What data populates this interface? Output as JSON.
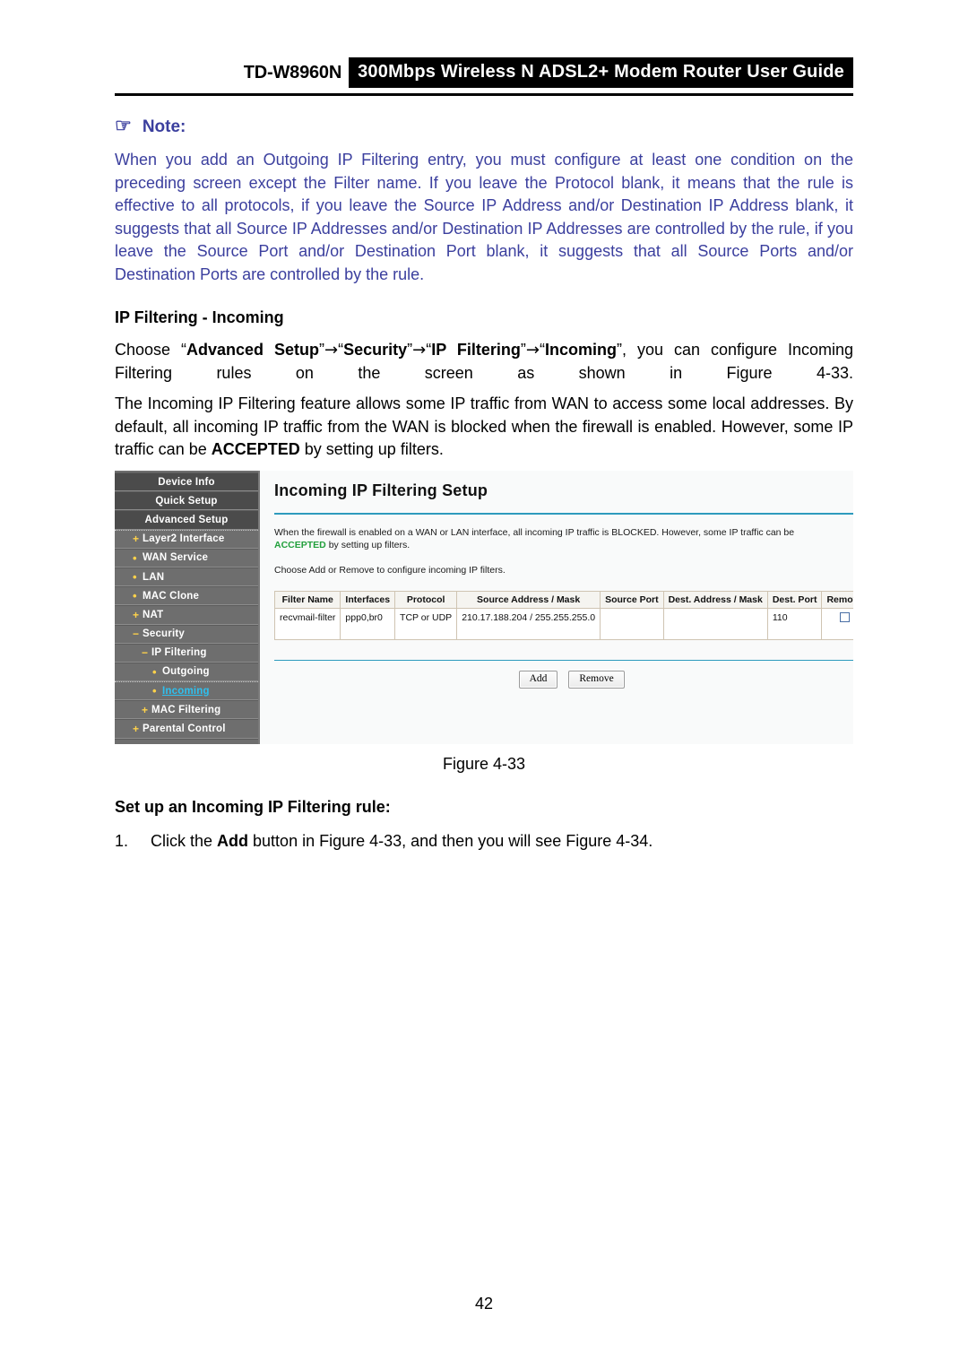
{
  "header": {
    "model": "TD-W8960N",
    "banner": "300Mbps Wireless N ADSL2+ Modem Router User Guide"
  },
  "note": {
    "icon": "pointing-hand",
    "icon_glyph": "☞",
    "label": "Note:",
    "color": "#3b3f9e",
    "body": "When you add an Outgoing IP Filtering entry, you must configure at least one condition on the preceding screen except the Filter name. If you leave the Protocol blank, it means that the rule is effective to all protocols, if you leave the Source IP Address and/or Destination IP Address blank, it suggests that all Source IP Addresses and/or Destination IP Addresses are controlled by the rule, if you leave the Source Port and/or Destination Port blank, it suggests that all Source Ports and/or Destination Ports are controlled by the rule."
  },
  "section": {
    "heading": "IP Filtering - Incoming",
    "choose_prefix": "Choose ",
    "path": [
      {
        "quote_open": "“",
        "bold": "Advanced Setup",
        "quote_close": "”"
      },
      {
        "quote_open": "“",
        "bold": "Security",
        "quote_close": "”"
      },
      {
        "quote_open": "“",
        "bold": "IP Filtering",
        "quote_close": "”"
      },
      {
        "quote_open": "“",
        "bold": "Incoming",
        "quote_close": "”"
      }
    ],
    "arrow": "→",
    "choose_suffix": ", you can configure Incoming Filtering rules on the screen as shown in Figure 4-33.",
    "feature_para_1": "The Incoming IP Filtering feature allows some IP traffic from WAN to access some local addresses. By default, all incoming IP traffic from the WAN is blocked when the firewall is enabled. However, some IP traffic can be ",
    "feature_accepted": "ACCEPTED",
    "feature_para_2": " by setting up filters."
  },
  "figure": {
    "caption": "Figure 4-33",
    "sidebar": {
      "items": [
        {
          "label": "Device Info",
          "level": "top",
          "marker": ""
        },
        {
          "label": "Quick Setup",
          "level": "top",
          "marker": ""
        },
        {
          "label": "Advanced Setup",
          "level": "top",
          "marker": ""
        },
        {
          "label": "Layer2 Interface",
          "level": "lvl1",
          "marker": "+"
        },
        {
          "label": "WAN Service",
          "level": "lvl1",
          "marker": "•"
        },
        {
          "label": "LAN",
          "level": "lvl1",
          "marker": "•"
        },
        {
          "label": "MAC Clone",
          "level": "lvl1",
          "marker": "•"
        },
        {
          "label": "NAT",
          "level": "lvl1",
          "marker": "+"
        },
        {
          "label": "Security",
          "level": "lvl1",
          "marker": "−"
        },
        {
          "label": "IP Filtering",
          "level": "lvl2",
          "marker": "−"
        },
        {
          "label": "Outgoing",
          "level": "lvl3",
          "marker": "•"
        },
        {
          "label": "Incoming",
          "level": "lvl3",
          "marker": "•",
          "active": true
        },
        {
          "label": "MAC Filtering",
          "level": "lvl2",
          "marker": "+"
        },
        {
          "label": "Parental Control",
          "level": "lvl1",
          "marker": "+"
        }
      ],
      "active_color": "#2ec0ef",
      "marker_color": "#ffd24a"
    },
    "panel": {
      "title": "Incoming IP Filtering Setup",
      "intro_1": "When the firewall is enabled on a WAN or LAN interface, all incoming IP traffic is BLOCKED. However, some IP traffic can be",
      "intro_accepted": "ACCEPTED",
      "intro_2": "by setting up filters.",
      "intro_3": "Choose Add or Remove to configure incoming IP filters.",
      "accepted_color": "#22a03c",
      "rule_color": "#2e9bbd",
      "table": {
        "columns": [
          "Filter Name",
          "Interfaces",
          "Protocol",
          "Source Address / Mask",
          "Source Port",
          "Dest. Address / Mask",
          "Dest. Port",
          "Remove"
        ],
        "rows": [
          {
            "filter_name": "recvmail-filter",
            "interfaces": "ppp0,br0",
            "protocol": "TCP or UDP",
            "source_address_mask": "210.17.188.204 / 255.255.255.0",
            "source_port": "",
            "dest_address_mask": "",
            "dest_port": "110",
            "remove_checked": false
          }
        ]
      },
      "buttons": {
        "add": "Add",
        "remove": "Remove"
      }
    }
  },
  "after_figure": {
    "heading": "Set up an Incoming IP Filtering rule:",
    "steps": [
      {
        "number": "1.",
        "text_1": "Click the ",
        "bold": "Add",
        "text_2": " button in Figure 4-33, and then you will see Figure 4-34."
      }
    ]
  },
  "footer": {
    "page_number": "42"
  }
}
